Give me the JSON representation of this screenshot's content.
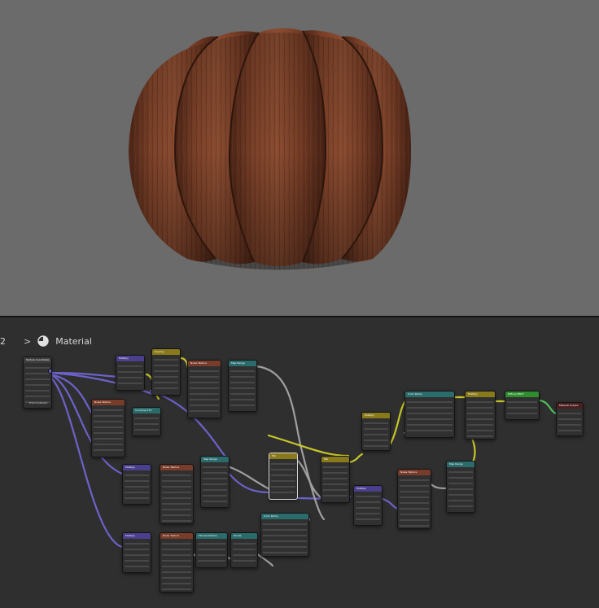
{
  "breadcrumb": {
    "prefix": "2",
    "material_label": "Material"
  },
  "nodes": [
    {
      "id": "texcoord",
      "header": "Texture Coordinate",
      "kind": "input",
      "footer": "From Instancer"
    },
    {
      "id": "mul1",
      "header": "Multiply",
      "kind": "math"
    },
    {
      "id": "overlay",
      "header": "Overlay",
      "kind": "color"
    },
    {
      "id": "noise1",
      "header": "Noise Texture",
      "kind": "tex"
    },
    {
      "id": "maprange1",
      "header": "Map Range",
      "kind": "conv"
    },
    {
      "id": "noise2",
      "header": "Noise Texture",
      "kind": "tex"
    },
    {
      "id": "combine",
      "header": "Combine XYZ",
      "kind": "conv"
    },
    {
      "id": "mul2",
      "header": "Multiply",
      "kind": "math"
    },
    {
      "id": "colorramp1",
      "header": "Color Ramp",
      "kind": "conv"
    },
    {
      "id": "mul3",
      "header": "Multiply",
      "kind": "color"
    },
    {
      "id": "diffuse",
      "header": "Diffuse BSDF",
      "kind": "shader"
    },
    {
      "id": "output",
      "header": "Material Output",
      "kind": "output"
    },
    {
      "id": "mul4",
      "header": "Multiply",
      "kind": "math"
    },
    {
      "id": "noise3",
      "header": "Noise Texture",
      "kind": "tex"
    },
    {
      "id": "maprange2",
      "header": "Map Range",
      "kind": "conv"
    },
    {
      "id": "mix1",
      "header": "Mix",
      "kind": "color"
    },
    {
      "id": "mix2",
      "header": "Mix",
      "kind": "color"
    },
    {
      "id": "mul5",
      "header": "Multiply",
      "kind": "math"
    },
    {
      "id": "noise4",
      "header": "Noise Texture",
      "kind": "tex"
    },
    {
      "id": "maprange3",
      "header": "Map Range",
      "kind": "conv"
    },
    {
      "id": "colorramp2",
      "header": "Color Ramp",
      "kind": "conv"
    },
    {
      "id": "mul6",
      "header": "Multiply",
      "kind": "math"
    },
    {
      "id": "noise5",
      "header": "Noise Texture",
      "kind": "tex"
    },
    {
      "id": "modulo",
      "header": "Floored Modulo",
      "kind": "conv"
    },
    {
      "id": "divide",
      "header": "Divide",
      "kind": "conv"
    }
  ],
  "colors": {
    "viewport_bg": "#6b6b6b",
    "editor_bg": "#2f2f2f",
    "wood_dark": "#5a2e1c",
    "wood_light": "#8a4a30",
    "link_vector": "#6d62c9",
    "link_float": "#a0a0a0",
    "link_color": "#c7c729",
    "link_shader": "#4fbe5a",
    "header_texture": "#793c2a",
    "header_math": "#4a3f8c",
    "header_converter": "#2b6b6b",
    "header_color": "#887a1a",
    "header_shader": "#2f8c2f",
    "header_output": "#4a1f1f"
  },
  "icons": {
    "material": "material-sphere-icon",
    "chevron": "chevron-right-icon"
  }
}
